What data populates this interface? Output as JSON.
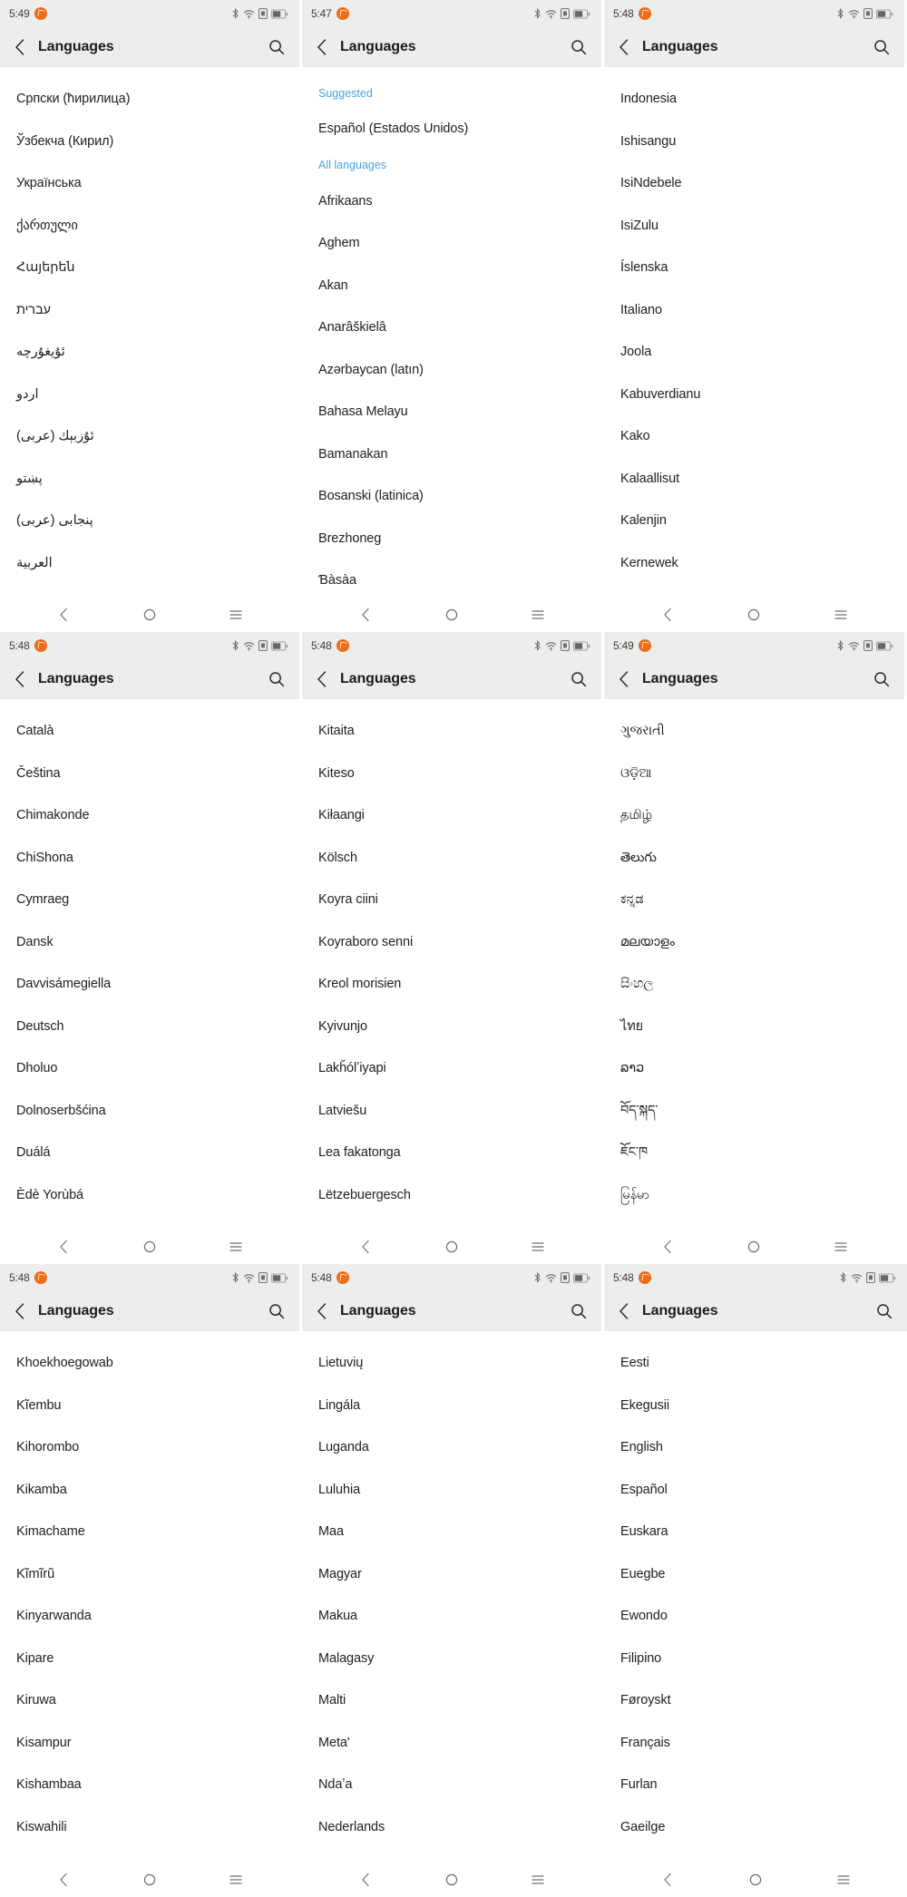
{
  "app": {
    "title": "Languages",
    "back_icon": "chevron-left-icon",
    "search_icon": "search-icon",
    "nav": {
      "back_icon": "nav-back-icon",
      "home_icon": "nav-home-icon",
      "recents_icon": "nav-recents-icon"
    },
    "status_icons": [
      "bluetooth-icon",
      "wifi-icon",
      "sim-icon",
      "battery-icon"
    ],
    "notification_icon": "notification-badge-icon"
  },
  "panels": [
    {
      "id": "panel-1",
      "time": "5:49",
      "sections": [
        {
          "header": null,
          "items": [
            {
              "label": "Српски (ћирилица)",
              "rtl": false
            },
            {
              "label": "Ўзбекча (Кирил)",
              "rtl": false
            },
            {
              "label": "Українська",
              "rtl": false
            },
            {
              "label": "ქართული",
              "rtl": false
            },
            {
              "label": "Հայերեն",
              "rtl": false
            },
            {
              "label": "עברית",
              "rtl": true
            },
            {
              "label": "ئۇيغۇرچە",
              "rtl": true
            },
            {
              "label": "اردو",
              "rtl": true
            },
            {
              "label": "ئۇزبېك (عربى)",
              "rtl": true
            },
            {
              "label": "پښتو",
              "rtl": true
            },
            {
              "label": "پنجابی (عربی)",
              "rtl": true
            },
            {
              "label": "العربية",
              "rtl": true
            }
          ]
        }
      ]
    },
    {
      "id": "panel-2",
      "time": "5:47",
      "sections": [
        {
          "header": "Suggested",
          "items": [
            {
              "label": "Español (Estados Unidos)",
              "rtl": false
            }
          ]
        },
        {
          "header": "All languages",
          "items": [
            {
              "label": "Afrikaans",
              "rtl": false
            },
            {
              "label": "Aghem",
              "rtl": false
            },
            {
              "label": "Akan",
              "rtl": false
            },
            {
              "label": "Anarâškielâ",
              "rtl": false
            },
            {
              "label": "Azərbaycan (latın)",
              "rtl": false
            },
            {
              "label": "Bahasa Melayu",
              "rtl": false
            },
            {
              "label": "Bamanakan",
              "rtl": false
            },
            {
              "label": "Bosanski (latinica)",
              "rtl": false
            },
            {
              "label": "Brezhoneg",
              "rtl": false
            },
            {
              "label": "Ɓàsàa",
              "rtl": false
            }
          ]
        }
      ]
    },
    {
      "id": "panel-3",
      "time": "5:48",
      "sections": [
        {
          "header": null,
          "items": [
            {
              "label": "Indonesia",
              "rtl": false
            },
            {
              "label": "Ishisangu",
              "rtl": false
            },
            {
              "label": "IsiNdebele",
              "rtl": false
            },
            {
              "label": "IsiZulu",
              "rtl": false
            },
            {
              "label": "Íslenska",
              "rtl": false
            },
            {
              "label": "Italiano",
              "rtl": false
            },
            {
              "label": "Joola",
              "rtl": false
            },
            {
              "label": "Kabuverdianu",
              "rtl": false
            },
            {
              "label": "Kako",
              "rtl": false
            },
            {
              "label": "Kalaallisut",
              "rtl": false
            },
            {
              "label": "Kalenjin",
              "rtl": false
            },
            {
              "label": "Kernewek",
              "rtl": false
            }
          ]
        }
      ]
    },
    {
      "id": "panel-4",
      "time": "5:48",
      "sections": [
        {
          "header": null,
          "items": [
            {
              "label": "Català",
              "rtl": false
            },
            {
              "label": "Čeština",
              "rtl": false
            },
            {
              "label": "Chimakonde",
              "rtl": false
            },
            {
              "label": "ChiShona",
              "rtl": false
            },
            {
              "label": "Cymraeg",
              "rtl": false
            },
            {
              "label": "Dansk",
              "rtl": false
            },
            {
              "label": "Davvisámegiella",
              "rtl": false
            },
            {
              "label": "Deutsch",
              "rtl": false
            },
            {
              "label": "Dholuo",
              "rtl": false
            },
            {
              "label": "Dolnoserbšćina",
              "rtl": false
            },
            {
              "label": "Duálá",
              "rtl": false
            },
            {
              "label": "Èdè Yorùbá",
              "rtl": false
            }
          ]
        }
      ]
    },
    {
      "id": "panel-5",
      "time": "5:48",
      "sections": [
        {
          "header": null,
          "items": [
            {
              "label": "Kitaita",
              "rtl": false
            },
            {
              "label": "Kiteso",
              "rtl": false
            },
            {
              "label": "Kiłaangi",
              "rtl": false
            },
            {
              "label": "Kölsch",
              "rtl": false
            },
            {
              "label": "Koyra ciini",
              "rtl": false
            },
            {
              "label": "Koyraboro senni",
              "rtl": false
            },
            {
              "label": "Kreol morisien",
              "rtl": false
            },
            {
              "label": "Kyivunjo",
              "rtl": false
            },
            {
              "label": "Lakȟólʼiyapi",
              "rtl": false
            },
            {
              "label": "Latviešu",
              "rtl": false
            },
            {
              "label": "Lea fakatonga",
              "rtl": false
            },
            {
              "label": "Lëtzebuergesch",
              "rtl": false
            }
          ]
        }
      ]
    },
    {
      "id": "panel-6",
      "time": "5:49",
      "sections": [
        {
          "header": null,
          "items": [
            {
              "label": "ગુજરાતી",
              "rtl": false
            },
            {
              "label": "ଓଡ଼ିଆ",
              "rtl": false
            },
            {
              "label": "தமிழ்",
              "rtl": false
            },
            {
              "label": "తెలుగు",
              "rtl": false
            },
            {
              "label": "ಕನ್ನಡ",
              "rtl": false
            },
            {
              "label": "മലയാളം",
              "rtl": false
            },
            {
              "label": "සිංහල",
              "rtl": false
            },
            {
              "label": "ไทย",
              "rtl": false
            },
            {
              "label": "ລາວ",
              "rtl": false
            },
            {
              "label": "བོད་སྐད་",
              "rtl": false
            },
            {
              "label": "ཇོང་ཁ",
              "rtl": false
            },
            {
              "label": "မြန်မာ",
              "rtl": false
            }
          ]
        }
      ]
    },
    {
      "id": "panel-7",
      "time": "5:48",
      "sections": [
        {
          "header": null,
          "items": [
            {
              "label": "Khoekhoegowab",
              "rtl": false
            },
            {
              "label": "Kĩembu",
              "rtl": false
            },
            {
              "label": "Kihorombo",
              "rtl": false
            },
            {
              "label": "Kikamba",
              "rtl": false
            },
            {
              "label": "Kimachame",
              "rtl": false
            },
            {
              "label": "Kĩmĩrũ",
              "rtl": false
            },
            {
              "label": "Kinyarwanda",
              "rtl": false
            },
            {
              "label": "Kipare",
              "rtl": false
            },
            {
              "label": "Kiruwa",
              "rtl": false
            },
            {
              "label": "Kisampur",
              "rtl": false
            },
            {
              "label": "Kishambaa",
              "rtl": false
            },
            {
              "label": "Kiswahili",
              "rtl": false
            }
          ]
        }
      ]
    },
    {
      "id": "panel-8",
      "time": "5:48",
      "sections": [
        {
          "header": null,
          "items": [
            {
              "label": "Lietuvių",
              "rtl": false
            },
            {
              "label": "Lingála",
              "rtl": false
            },
            {
              "label": "Luganda",
              "rtl": false
            },
            {
              "label": "Luluhia",
              "rtl": false
            },
            {
              "label": "Maa",
              "rtl": false
            },
            {
              "label": "Magyar",
              "rtl": false
            },
            {
              "label": "Makua",
              "rtl": false
            },
            {
              "label": "Malagasy",
              "rtl": false
            },
            {
              "label": "Malti",
              "rtl": false
            },
            {
              "label": "Meta'",
              "rtl": false
            },
            {
              "label": "Ndaʼa",
              "rtl": false
            },
            {
              "label": "Nederlands",
              "rtl": false
            }
          ]
        }
      ]
    },
    {
      "id": "panel-9",
      "time": "5:48",
      "sections": [
        {
          "header": null,
          "items": [
            {
              "label": "Eesti",
              "rtl": false
            },
            {
              "label": "Ekegusii",
              "rtl": false
            },
            {
              "label": "English",
              "rtl": false
            },
            {
              "label": "Español",
              "rtl": false
            },
            {
              "label": "Euskara",
              "rtl": false
            },
            {
              "label": "Euegbe",
              "rtl": false
            },
            {
              "label": "Ewondo",
              "rtl": false
            },
            {
              "label": "Filipino",
              "rtl": false
            },
            {
              "label": "Føroyskt",
              "rtl": false
            },
            {
              "label": "Français",
              "rtl": false
            },
            {
              "label": "Furlan",
              "rtl": false
            },
            {
              "label": "Gaeilge",
              "rtl": false
            }
          ]
        }
      ]
    }
  ],
  "colors": {
    "accent_orange": "#ef6c1a",
    "section_blue": "#4aa3df",
    "appbar_bg": "#ededeb",
    "text_primary": "#212121"
  }
}
